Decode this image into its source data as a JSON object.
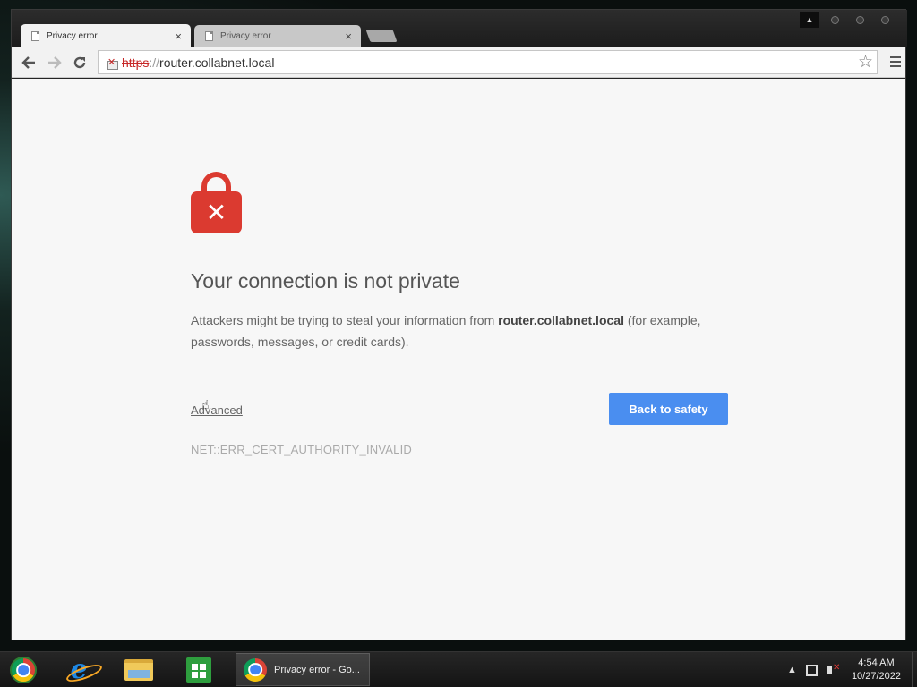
{
  "browser": {
    "tabs": [
      {
        "title": "Privacy error",
        "active": true
      },
      {
        "title": "Privacy error",
        "active": false
      }
    ],
    "address": {
      "scheme": "https",
      "separator": "://",
      "host": "router.collabnet.local"
    },
    "icons": {
      "back": "back-arrow-icon",
      "forward": "forward-arrow-icon",
      "reload": "reload-icon",
      "bookmark": "star-icon",
      "menu": "hamburger-menu-icon",
      "security": "insecure-lock-icon"
    }
  },
  "page": {
    "headline": "Your connection is not private",
    "desc_prefix": "Attackers might be trying to steal your information from ",
    "desc_host": "router.collabnet.local",
    "desc_suffix": " (for example, passwords, messages, or credit cards).",
    "advanced_label": "Advanced",
    "back_to_safety_label": "Back to safety",
    "error_code": "NET::ERR_CERT_AUTHORITY_INVALID",
    "lock_color": "#db3a30",
    "button_color": "#4a8ef0"
  },
  "taskbar": {
    "pinned": [
      "chrome-icon",
      "internet-explorer-icon",
      "file-explorer-icon",
      "store-icon"
    ],
    "active_task_label": "Privacy error - Go...",
    "time": "4:54 AM",
    "date": "10/27/2022"
  }
}
